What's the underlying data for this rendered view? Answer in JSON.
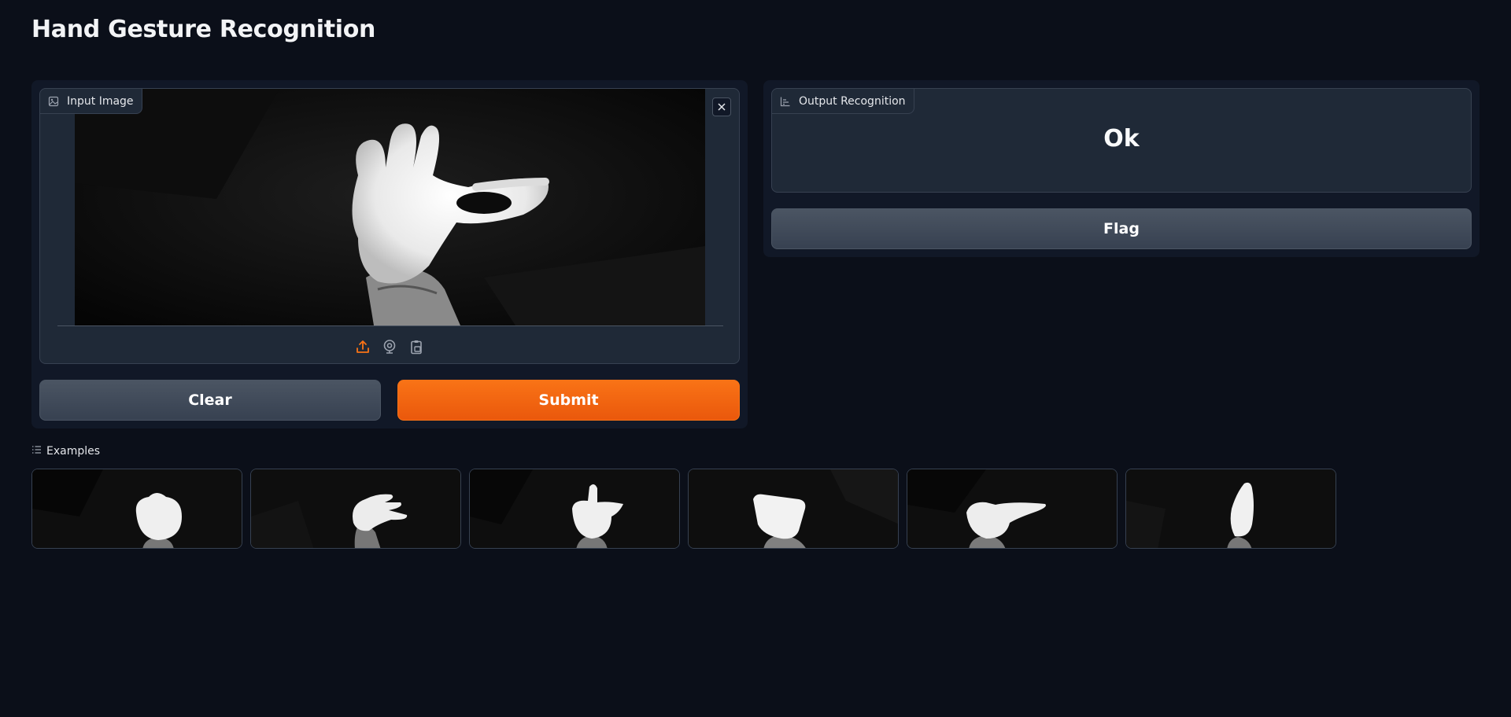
{
  "app": {
    "title": "Hand Gesture Recognition"
  },
  "input": {
    "label": "Input Image",
    "label_icon": "image-icon",
    "close_icon": "close-icon",
    "sources": [
      {
        "name": "upload-icon",
        "color": "#f97316"
      },
      {
        "name": "webcam-icon",
        "color": "#9ca3af"
      },
      {
        "name": "clipboard-icon",
        "color": "#9ca3af"
      }
    ]
  },
  "buttons": {
    "clear_label": "Clear",
    "submit_label": "Submit",
    "flag_label": "Flag"
  },
  "output": {
    "label": "Output Recognition",
    "label_icon": "bar-chart-icon",
    "value": "Ok"
  },
  "examples": {
    "label": "Examples",
    "label_icon": "list-icon",
    "items": [
      {
        "gesture_icon": "fist-hand-image"
      },
      {
        "gesture_icon": "flat-hand-image"
      },
      {
        "gesture_icon": "index-up-hand-image"
      },
      {
        "gesture_icon": "palm-hand-image"
      },
      {
        "gesture_icon": "thumb-hand-image"
      },
      {
        "gesture_icon": "raised-hand-image"
      }
    ]
  },
  "colors": {
    "background": "#0b0f19",
    "panel": "#111827",
    "block": "#1f2937",
    "accent": "#f97316"
  }
}
